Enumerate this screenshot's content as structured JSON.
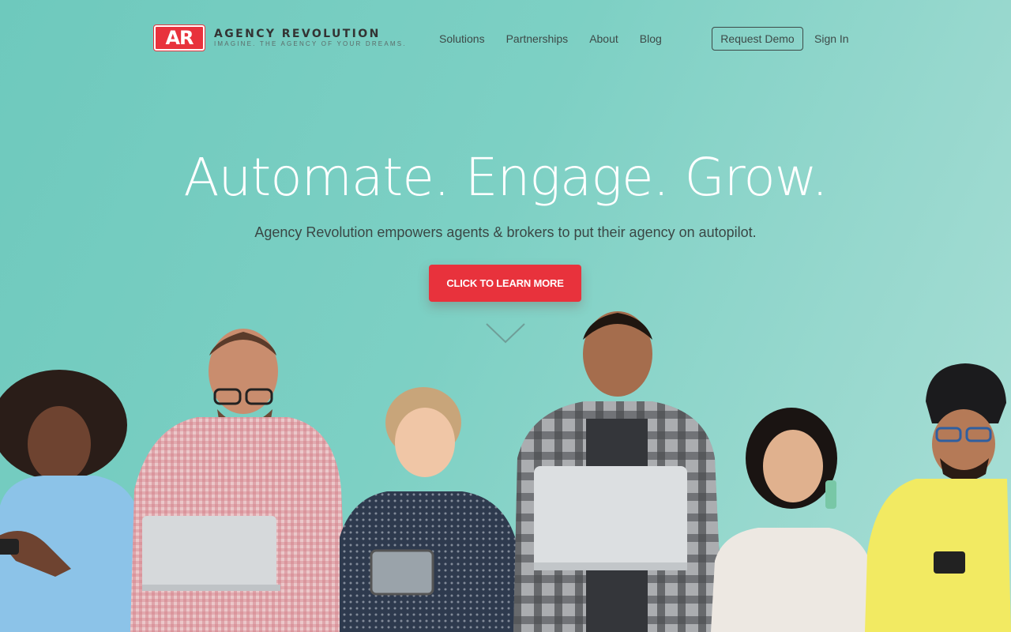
{
  "brand": {
    "badge": "AR",
    "name": "AGENCY REVOLUTION",
    "tagline": "IMAGINE. THE AGENCY OF YOUR DREAMS."
  },
  "nav": {
    "items": [
      {
        "label": "Solutions"
      },
      {
        "label": "Partnerships"
      },
      {
        "label": "About"
      },
      {
        "label": "Blog"
      }
    ],
    "request_demo": "Request Demo",
    "sign_in": "Sign In"
  },
  "hero": {
    "title": "Automate. Engage. Grow.",
    "subtitle": "Agency Revolution empowers agents & brokers to put their agency on autopilot.",
    "cta": "CLICK TO LEARN MORE",
    "scroll_icon": "chevron-down-icon"
  },
  "colors": {
    "accent": "#e8323c",
    "background": "#7dd0c4",
    "text": "#3d4a48"
  },
  "image": {
    "subject": "six people with phones, laptops and a tablet"
  }
}
